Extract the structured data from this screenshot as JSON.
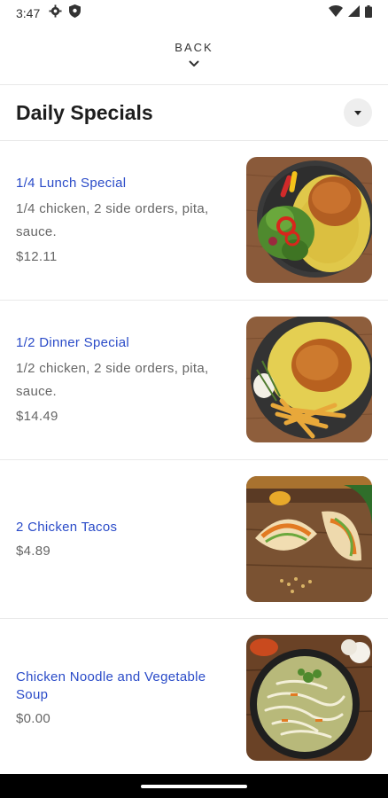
{
  "status_bar": {
    "time": "3:47",
    "left_icons": [
      "settings-icon",
      "shield-icon"
    ],
    "right_icons": [
      "wifi-icon",
      "signal-icon",
      "battery-icon"
    ]
  },
  "back": {
    "label": "BACK",
    "icon": "chevron-down-icon"
  },
  "section": {
    "title": "Daily Specials",
    "dropdown_icon": "caret-down-icon"
  },
  "items": [
    {
      "name": "1/4 Lunch Special",
      "description": "1/4 chicken, 2 side orders, pita, sauce.",
      "price": "$12.11"
    },
    {
      "name": "1/2 Dinner Special",
      "description": "1/2 chicken, 2 side orders, pita, sauce.",
      "price": "$14.49"
    },
    {
      "name": "2 Chicken Tacos",
      "description": "",
      "price": "$4.89"
    },
    {
      "name": "Chicken Noodle and Vegetable Soup",
      "description": "",
      "price": "$0.00"
    }
  ],
  "colors": {
    "item_name": "#2a4bc8",
    "secondary_text": "#666666",
    "divider": "#e9e9e9"
  }
}
